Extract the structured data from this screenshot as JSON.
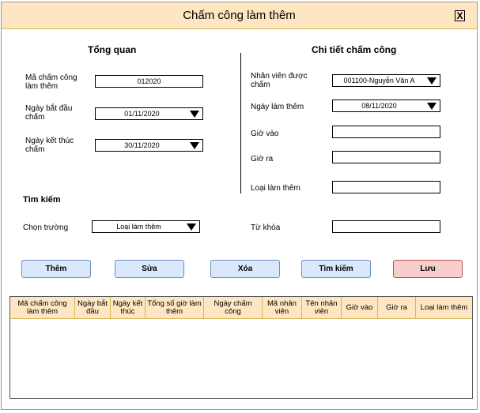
{
  "window": {
    "title": "Chấm công làm thêm",
    "close_label": "X"
  },
  "overview": {
    "heading": "Tổng quan",
    "code_label": "Mã chấm công làm thêm",
    "code_value": "012020",
    "start_label": "Ngày bắt đầu chấm",
    "start_value": "01/11/2020",
    "end_label": "Ngày kết thúc chấm",
    "end_value": "30/11/2020"
  },
  "detail": {
    "heading": "Chi tiết chấm công",
    "employee_label": "Nhân viên được chấm",
    "employee_value": "001100-Nguyễn Văn A",
    "ot_date_label": "Ngày làm thêm",
    "ot_date_value": "08/11/2020",
    "checkin_label": "Giờ vào",
    "checkin_value": "",
    "checkout_label": "Giờ ra",
    "checkout_value": "",
    "ot_type_label": "Loại làm thêm",
    "ot_type_value": ""
  },
  "search": {
    "heading": "Tìm kiếm",
    "field_label": "Chọn trường",
    "field_value": "Loại làm thêm",
    "keyword_label": "Từ khóa",
    "keyword_value": ""
  },
  "buttons": {
    "add": "Thêm",
    "edit": "Sửa",
    "delete": "Xóa",
    "search": "Tìm kiếm",
    "save": "Lưu"
  },
  "table": {
    "columns": [
      "Mã chấm công làm thêm",
      "Ngày bắt đầu",
      "Ngày kết thúc",
      "Tổng số giờ làm thêm",
      "Ngày chấm công",
      "Mã nhân viên",
      "Tên nhân viên",
      "Giờ vào",
      "Giờ ra",
      "Loại làm thêm"
    ]
  },
  "colors": {
    "header_fill": "#ffe6c2",
    "button_blue": "#dae8fc",
    "button_red": "#f8cecc"
  }
}
